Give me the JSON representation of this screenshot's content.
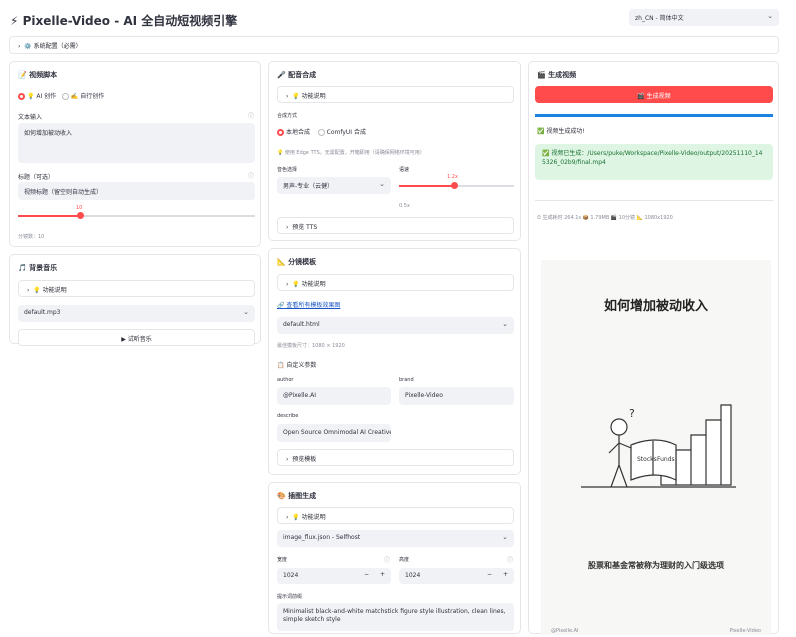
{
  "app": {
    "title": "⚡ Pixelle-Video - AI 全自动短视频引擎",
    "language": "zh_CN - 简体中文"
  },
  "config_bar": {
    "label": "⚙️ 系统配置（必需）"
  },
  "script_panel": {
    "title": "📝 视频脚本",
    "mode_ai": "💡 AI 创作",
    "mode_custom": "✍️ 自行创作",
    "text_label": "文本输入",
    "text_value": "如何增加被动收入",
    "title_label": "标题（可选）",
    "title_placeholder": "视频标题（留空则自动生成）",
    "slider_value": "10",
    "scenes_label": "分镜数：10"
  },
  "music_panel": {
    "title": "🎵 背景音乐",
    "help": "💡 功能说明",
    "file": "default.mp3",
    "preview": "▶ 试听音乐"
  },
  "tts_panel": {
    "title": "🎤 配音合成",
    "help": "💡 功能说明",
    "method_label": "合成方式",
    "opt_local": "本地合成",
    "opt_comfy": "ComfyUI 合成",
    "note": "💡 使用 Edge TTS，无需配置，开箱即用（请确保网络环境可用）",
    "voice_label": "音色选择",
    "voice_value": "男声-专业（云健）",
    "speed_label": "语速",
    "speed_value": "1.2x",
    "speed_min": "0.5x",
    "preview": "预览 TTS",
    "speed_fraction": 0.4
  },
  "template_panel": {
    "title": "📐 分镜模板",
    "help": "💡 功能说明",
    "link": "🔗 查看所有模板效果图",
    "template": "default.html",
    "size": "最佳模板尺寸：1080 × 1920",
    "custom_title": "📋 自定义参数",
    "author_label": "author",
    "author_value": "@Pixelle.AI",
    "brand_label": "brand",
    "brand_value": "Pixelle-Video",
    "describe_label": "describe",
    "describe_value": "Open Source Omnimodal AI Creative",
    "preview": "预览模板"
  },
  "image_panel": {
    "title": "🎨 插图生成",
    "help": "💡 功能说明",
    "workflow": "image_flux.json - Selfhost",
    "width_label": "宽度",
    "width_value": "1024",
    "height_label": "高度",
    "height_value": "1024",
    "prompt_label": "提示词前缀",
    "prompt_value": "Minimalist black-and-white matchstick figure style illustration, clean lines, simple sketch style"
  },
  "output_panel": {
    "title": "🎬 生成视频",
    "generate": "🎬 生成视频",
    "success": "✅ 视频生成成功!",
    "saved_prefix": "✅ 视频已生成：",
    "saved_path": "/Users/puke/Workspace/Pixelle-Video/output/20251110_145326_02b9/final.mp4",
    "stats": "⏱ 生成耗时 264.1s 📦 1.79MB 🎬 10分镜 📐 1080x1920",
    "progress": 1.0
  },
  "preview": {
    "heading": "如何增加被动收入",
    "caption": "股票和基金常被称为理财的入门级选项",
    "author": "@Pixelle.AI",
    "brand": "Pixelle-Video",
    "book_left": "Stocks",
    "book_right": "Funds"
  }
}
